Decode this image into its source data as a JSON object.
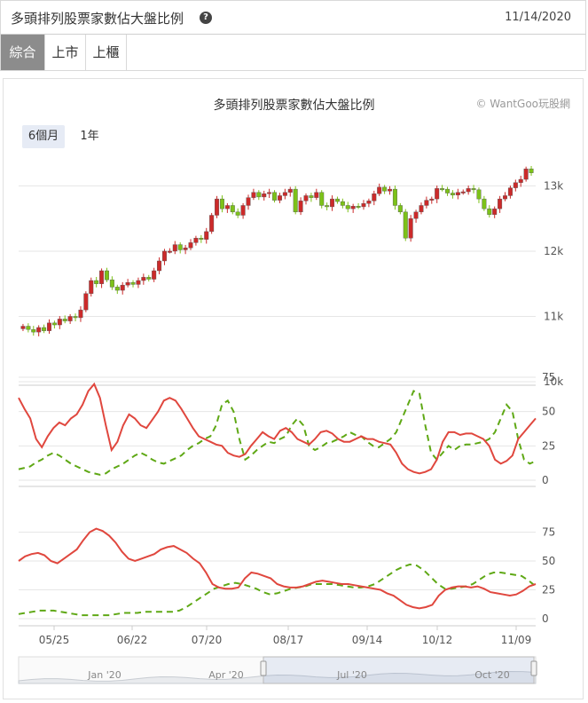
{
  "header": {
    "title": "多頭排列股票家數佔大盤比例",
    "help_icon": "?",
    "date": "11/14/2020"
  },
  "tabs": [
    {
      "label": "綜合",
      "active": true
    },
    {
      "label": "上市",
      "active": false
    },
    {
      "label": "上櫃",
      "active": false
    }
  ],
  "chart": {
    "title": "多頭排列股票家數佔大盤比例",
    "credit": "© WantGoo玩股網",
    "range_buttons": [
      {
        "label": "6個月",
        "active": true
      },
      {
        "label": "1年",
        "active": false
      }
    ]
  },
  "colors": {
    "up_candle": "#cc2a2a",
    "down_candle": "#7cc218",
    "red_line": "#e0473e",
    "green_dash": "#5fa815",
    "grid": "#e6e6e6"
  },
  "chart_data": {
    "type": "line",
    "x_tick_labels": [
      "05/25",
      "06/22",
      "07/20",
      "08/17",
      "09/14",
      "10/12",
      "11/09"
    ],
    "navigator_labels": [
      "Jan '20",
      "Apr '20",
      "Jul '20",
      "Oct '20"
    ],
    "price": {
      "series": "index candlesticks",
      "y_ticks": [
        "10k",
        "11k",
        "12k",
        "13k"
      ],
      "ylim": [
        10000,
        13400
      ],
      "close": [
        10850,
        10800,
        10760,
        10830,
        10780,
        10900,
        10870,
        10960,
        10930,
        11000,
        10980,
        11100,
        11350,
        11550,
        11500,
        11700,
        11560,
        11450,
        11400,
        11480,
        11520,
        11490,
        11550,
        11600,
        11570,
        11700,
        11850,
        12000,
        12000,
        12100,
        12020,
        12050,
        12130,
        12200,
        12180,
        12300,
        12550,
        12800,
        12650,
        12700,
        12600,
        12550,
        12700,
        12820,
        12900,
        12830,
        12880,
        12900,
        12780,
        12850,
        12900,
        12950,
        12600,
        12770,
        12850,
        12820,
        12900,
        12700,
        12680,
        12800,
        12760,
        12700,
        12650,
        12690,
        12680,
        12730,
        12770,
        12880,
        12980,
        12920,
        12950,
        12700,
        12600,
        12200,
        12500,
        12600,
        12700,
        12780,
        12800,
        12960,
        12950,
        12890,
        12860,
        12900,
        12910,
        12960,
        12940,
        12800,
        12650,
        12560,
        12650,
        12800,
        12850,
        12970,
        13050,
        13100,
        13260,
        13200
      ]
    },
    "panel1": {
      "y_ticks": [
        "0",
        "25",
        "50",
        "75"
      ],
      "ylim": [
        0,
        75
      ],
      "red_line": [
        60,
        52,
        45,
        30,
        24,
        32,
        38,
        42,
        40,
        45,
        48,
        55,
        65,
        70,
        60,
        40,
        22,
        28,
        40,
        48,
        45,
        40,
        38,
        44,
        50,
        58,
        60,
        58,
        52,
        45,
        38,
        32,
        30,
        28,
        26,
        25,
        20,
        18,
        17,
        19,
        25,
        30,
        35,
        32,
        30,
        36,
        38,
        35,
        30,
        28,
        26,
        30,
        35,
        36,
        34,
        30,
        28,
        28,
        30,
        32,
        30,
        30,
        28,
        27,
        26,
        20,
        12,
        8,
        6,
        5,
        6,
        8,
        15,
        28,
        35,
        35,
        33,
        34,
        34,
        32,
        30,
        25,
        15,
        12,
        14,
        18,
        30,
        35,
        40,
        45
      ],
      "green_dash": [
        8,
        9,
        10,
        13,
        15,
        18,
        20,
        18,
        15,
        12,
        10,
        8,
        6,
        5,
        4,
        5,
        8,
        10,
        12,
        15,
        18,
        20,
        18,
        15,
        13,
        12,
        14,
        16,
        18,
        22,
        25,
        27,
        30,
        32,
        40,
        55,
        58,
        50,
        30,
        15,
        18,
        22,
        25,
        28,
        27,
        30,
        32,
        40,
        45,
        40,
        25,
        22,
        24,
        27,
        28,
        30,
        32,
        35,
        33,
        32,
        28,
        25,
        24,
        27,
        30,
        35,
        45,
        55,
        65,
        63,
        40,
        20,
        15,
        20,
        25,
        22,
        25,
        26,
        26,
        27,
        28,
        30,
        35,
        45,
        55,
        50,
        30,
        15,
        12,
        14
      ]
    },
    "panel2": {
      "y_ticks": [
        "0",
        "25",
        "50",
        "75"
      ],
      "ylim": [
        0,
        90
      ],
      "red_line": [
        50,
        54,
        56,
        57,
        55,
        50,
        48,
        52,
        56,
        60,
        68,
        75,
        78,
        76,
        72,
        66,
        58,
        52,
        50,
        52,
        54,
        56,
        60,
        62,
        63,
        60,
        57,
        52,
        48,
        40,
        30,
        27,
        26,
        26,
        27,
        35,
        40,
        39,
        37,
        35,
        30,
        28,
        27,
        27,
        28,
        30,
        32,
        33,
        32,
        31,
        30,
        30,
        29,
        28,
        27,
        26,
        25,
        22,
        20,
        16,
        12,
        10,
        9,
        10,
        12,
        20,
        25,
        27,
        28,
        28,
        27,
        28,
        26,
        23,
        22,
        21,
        20,
        21,
        24,
        28,
        30
      ],
      "green_dash": [
        4,
        5,
        6,
        7,
        7,
        7,
        6,
        5,
        4,
        3,
        3,
        3,
        3,
        3,
        4,
        5,
        5,
        5,
        6,
        6,
        6,
        6,
        6,
        7,
        10,
        14,
        18,
        22,
        26,
        28,
        30,
        31,
        30,
        28,
        26,
        23,
        21,
        22,
        24,
        26,
        27,
        28,
        30,
        30,
        30,
        30,
        29,
        28,
        27,
        27,
        28,
        30,
        34,
        38,
        42,
        45,
        47,
        46,
        42,
        36,
        30,
        26,
        26,
        27,
        28,
        30,
        34,
        38,
        40,
        40,
        39,
        38,
        37,
        33,
        28
      ]
    }
  }
}
